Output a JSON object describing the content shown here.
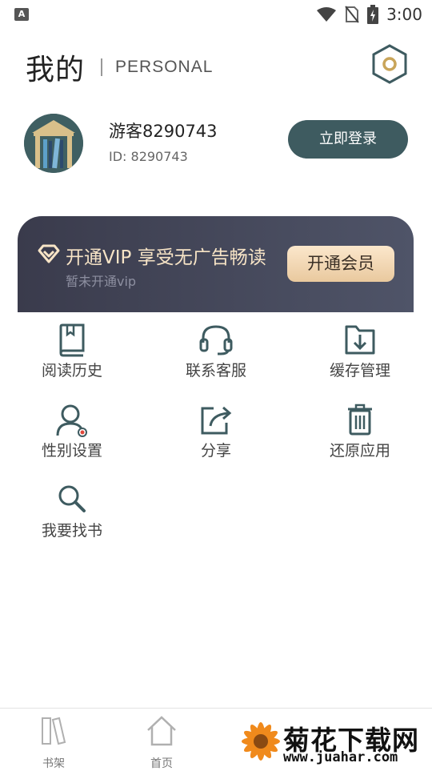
{
  "status_bar": {
    "time": "3:00",
    "app_badge": "A"
  },
  "header": {
    "title": "我的",
    "subtitle": "PERSONAL"
  },
  "profile": {
    "username": "游客8290743",
    "user_id": "ID: 8290743",
    "login_label": "立即登录"
  },
  "vip": {
    "title": "开通VIP 享受无广告畅读",
    "status": "暂未开通vip",
    "button_label": "开通会员"
  },
  "menu": [
    {
      "label": "阅读历史",
      "icon": "book-icon"
    },
    {
      "label": "联系客服",
      "icon": "headset-icon"
    },
    {
      "label": "缓存管理",
      "icon": "download-folder-icon"
    },
    {
      "label": "性别设置",
      "icon": "user-gender-icon"
    },
    {
      "label": "分享",
      "icon": "share-icon"
    },
    {
      "label": "还原应用",
      "icon": "trash-icon"
    },
    {
      "label": "我要找书",
      "icon": "search-icon"
    }
  ],
  "tabbar": {
    "tabs": [
      {
        "label": "书架",
        "icon": "bookshelf-icon"
      },
      {
        "label": "首页",
        "icon": "home-icon"
      }
    ]
  },
  "watermark": {
    "text": "菊花下载网",
    "url": "www.juahar.com"
  },
  "colors": {
    "accent": "#3e5b60",
    "vip_bg": "#3a3b4c",
    "vip_text": "#f7e4c6",
    "gold": "#c9a55a"
  }
}
